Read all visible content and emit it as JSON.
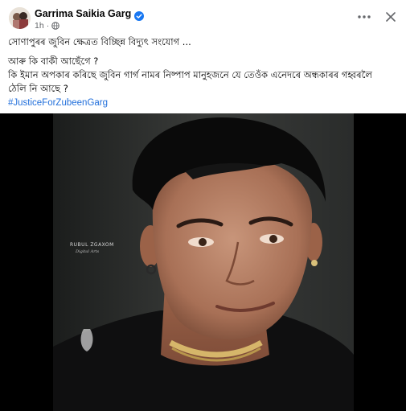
{
  "post": {
    "author": "Garrima Saikia Garg",
    "verified": true,
    "time": "1h",
    "separator": "·",
    "privacy_icon": "globe-icon",
    "lines": [
      "সোণাপুৰৰ জুবিন ক্ষেত্ৰত বিচ্ছিন্ন বিদ্যুৎ সংযোগ ...",
      "আৰু কি বাকী আছেঁগে ?",
      "কি ইমান অপকাৰ কৰিছে জুবিন গাৰ্গ নামৰ নিষ্পাপ মানুহজনে যে তেওঁক এনেদৰে অন্ধকাৰৰ গহ্বৰলৈ",
      "ঠেলি নি আছে ?"
    ],
    "hashtag": "#JusticeForZubeenGarg"
  },
  "actions": {
    "more_icon": "more-horizontal-icon",
    "close_icon": "close-icon"
  },
  "photo": {
    "watermark": "RUBUL ZGAXOM",
    "watermark_sub": "Digital Arts"
  },
  "colors": {
    "text": "#050505",
    "meta": "#65676b",
    "hashtag": "#216fdb",
    "verified": "#1877f2",
    "photo_bg": "#000000"
  }
}
